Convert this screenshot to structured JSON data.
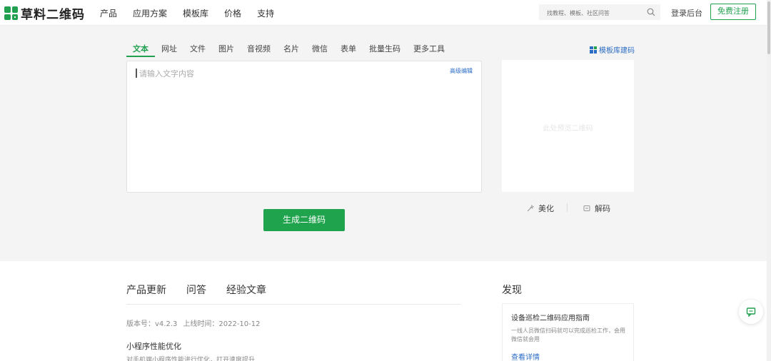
{
  "header": {
    "logo_text": "草料二维码",
    "nav": [
      "产品",
      "应用方案",
      "模板库",
      "价格",
      "支持"
    ],
    "search_placeholder": "找教程、模板、社区问答",
    "login": "登录后台",
    "register": "免费注册"
  },
  "generator": {
    "tabs": [
      "文本",
      "网址",
      "文件",
      "图片",
      "音视频",
      "名片",
      "微信",
      "表单",
      "批量生码",
      "更多工具"
    ],
    "active_tab": "文本",
    "template_link": "模板库建码",
    "editor_placeholder": "请输入文字内容",
    "advanced_edit": "高级编辑",
    "generate_button": "生成二维码",
    "preview_text": "此处预览二维码",
    "beautify": "美化",
    "decode": "解码"
  },
  "updates": {
    "tabs": [
      "产品更新",
      "问答",
      "经验文章"
    ],
    "version": "版本号：v4.2.3",
    "release_time": "上线时间：2022-10-12",
    "item_title": "小程序性能优化",
    "item_desc": "对手机端小程序性能进行优化，打开速度提升"
  },
  "discover": {
    "title": "发现",
    "card_title": "设备巡检二维码应用指南",
    "card_desc": "一线人员微信扫码就可以完成巡检工作，会用微信就会用",
    "card_link": "查看详情"
  },
  "colors": {
    "brand_green": "#21a04f",
    "link_blue": "#2b6cc4"
  },
  "icons": [
    "logo-icon",
    "search-icon",
    "template-grid-icon",
    "beautify-icon",
    "decode-icon",
    "chat-icon"
  ]
}
